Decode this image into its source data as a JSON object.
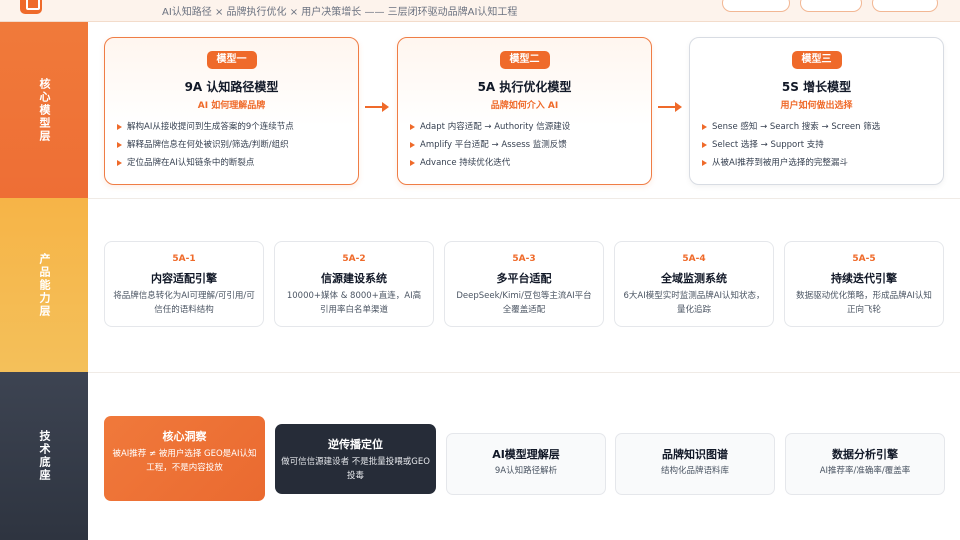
{
  "header": {
    "subtitle": "AI认知路径 × 品牌执行优化 × 用户决策增长 —— 三层闭环驱动品牌AI认知工程"
  },
  "layers": [
    {
      "label": "核心模型层"
    },
    {
      "label": "产品能力层"
    },
    {
      "label": "技术底座"
    }
  ],
  "models": [
    {
      "tag": "模型一",
      "title": "9A 认知路径模型",
      "subtitle": "AI 如何理解品牌",
      "bullets": [
        "解构AI从接收提问到生成答案的9个连续节点",
        "解释品牌信息在何处被识别/筛选/判断/组织",
        "定位品牌在AI认知链条中的断裂点"
      ]
    },
    {
      "tag": "模型二",
      "title": "5A 执行优化模型",
      "subtitle": "品牌如何介入 AI",
      "bullets": [
        "Adapt 内容适配 → Authority 信源建设",
        "Amplify 平台适配 → Assess 监测反馈",
        "Advance 持续优化迭代"
      ]
    },
    {
      "tag": "模型三",
      "title": "5S 增长模型",
      "subtitle": "用户如何做出选择",
      "bullets": [
        "Sense 感知 → Search 搜索 → Screen 筛选",
        "Select 选择 → Support 支持",
        "从被AI推荐到被用户选择的完整漏斗"
      ]
    }
  ],
  "capabilities": [
    {
      "code": "5A-1",
      "name": "内容适配引擎",
      "desc": "将品牌信息转化为AI可理解/可引用/可信任的语料结构"
    },
    {
      "code": "5A-2",
      "name": "信源建设系统",
      "desc": "10000+媒体 & 8000+直连，AI高引用率白名单渠道"
    },
    {
      "code": "5A-3",
      "name": "多平台适配",
      "desc": "DeepSeek/Kimi/豆包等主流AI平台全覆盖适配"
    },
    {
      "code": "5A-4",
      "name": "全域监测系统",
      "desc": "6大AI模型实时监测品牌AI认知状态，量化追踪"
    },
    {
      "code": "5A-5",
      "name": "持续迭代引擎",
      "desc": "数据驱动优化策略，形成品牌AI认知正向飞轮"
    }
  ],
  "tech": [
    {
      "name": "核心洞察",
      "desc": "被AI推荐 ≠ 被用户选择 GEO是AI认知工程，不是内容投放"
    },
    {
      "name": "逆传播定位",
      "desc": "做可信信源建设者 不是批量投喂或GEO投毒"
    },
    {
      "name": "AI模型理解层",
      "desc": "9A认知路径解析"
    },
    {
      "name": "品牌知识图谱",
      "desc": "结构化品牌语料库"
    },
    {
      "name": "数据分析引擎",
      "desc": "AI推荐率/准确率/覆盖率"
    }
  ],
  "colors": {
    "accent": "#ef6a2a",
    "dark": "#2e3440",
    "amber": "#f5b84d"
  },
  "icons": [
    "logo-icon",
    "arrow-right-icon",
    "bullet-triangle-icon"
  ]
}
